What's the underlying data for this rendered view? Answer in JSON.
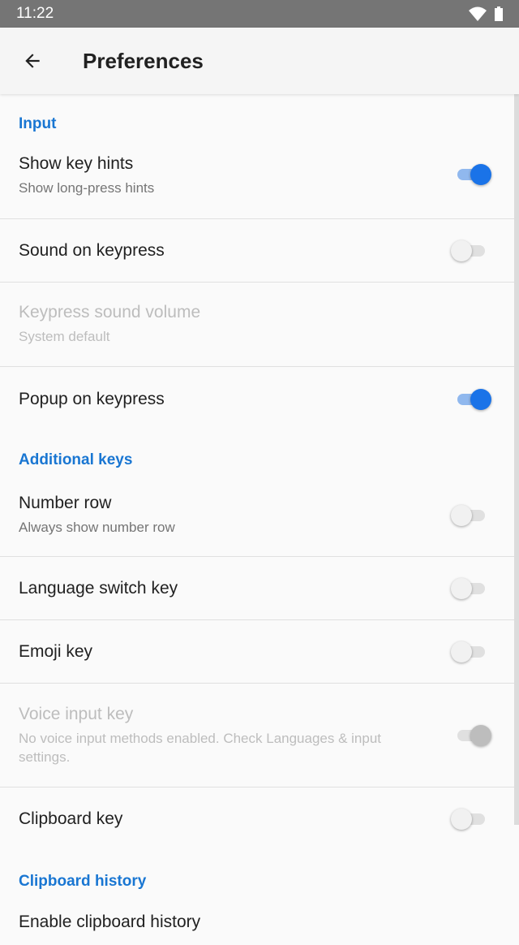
{
  "status_bar": {
    "time": "11:22"
  },
  "app_bar": {
    "title": "Preferences"
  },
  "sections": [
    {
      "header": "Input"
    },
    {
      "header": "Additional keys"
    },
    {
      "header": "Clipboard history"
    }
  ],
  "prefs": {
    "show_key_hints": {
      "title": "Show key hints",
      "summary": "Show long-press hints",
      "enabled": true
    },
    "sound_on_keypress": {
      "title": "Sound on keypress",
      "enabled": false
    },
    "keypress_sound_volume": {
      "title": "Keypress sound volume",
      "summary": "System default"
    },
    "popup_on_keypress": {
      "title": "Popup on keypress",
      "enabled": true
    },
    "number_row": {
      "title": "Number row",
      "summary": "Always show number row",
      "enabled": false
    },
    "language_switch_key": {
      "title": "Language switch key",
      "enabled": false
    },
    "emoji_key": {
      "title": "Emoji key",
      "enabled": false
    },
    "voice_input_key": {
      "title": "Voice input key",
      "summary": "No voice input methods enabled. Check Languages & input settings.",
      "enabled": true
    },
    "clipboard_key": {
      "title": "Clipboard key",
      "enabled": false
    },
    "enable_clipboard_history": {
      "title": "Enable clipboard history"
    }
  },
  "colors": {
    "accent": "#1a73e8",
    "section_header": "#1976d2",
    "status_bar": "#757575"
  }
}
